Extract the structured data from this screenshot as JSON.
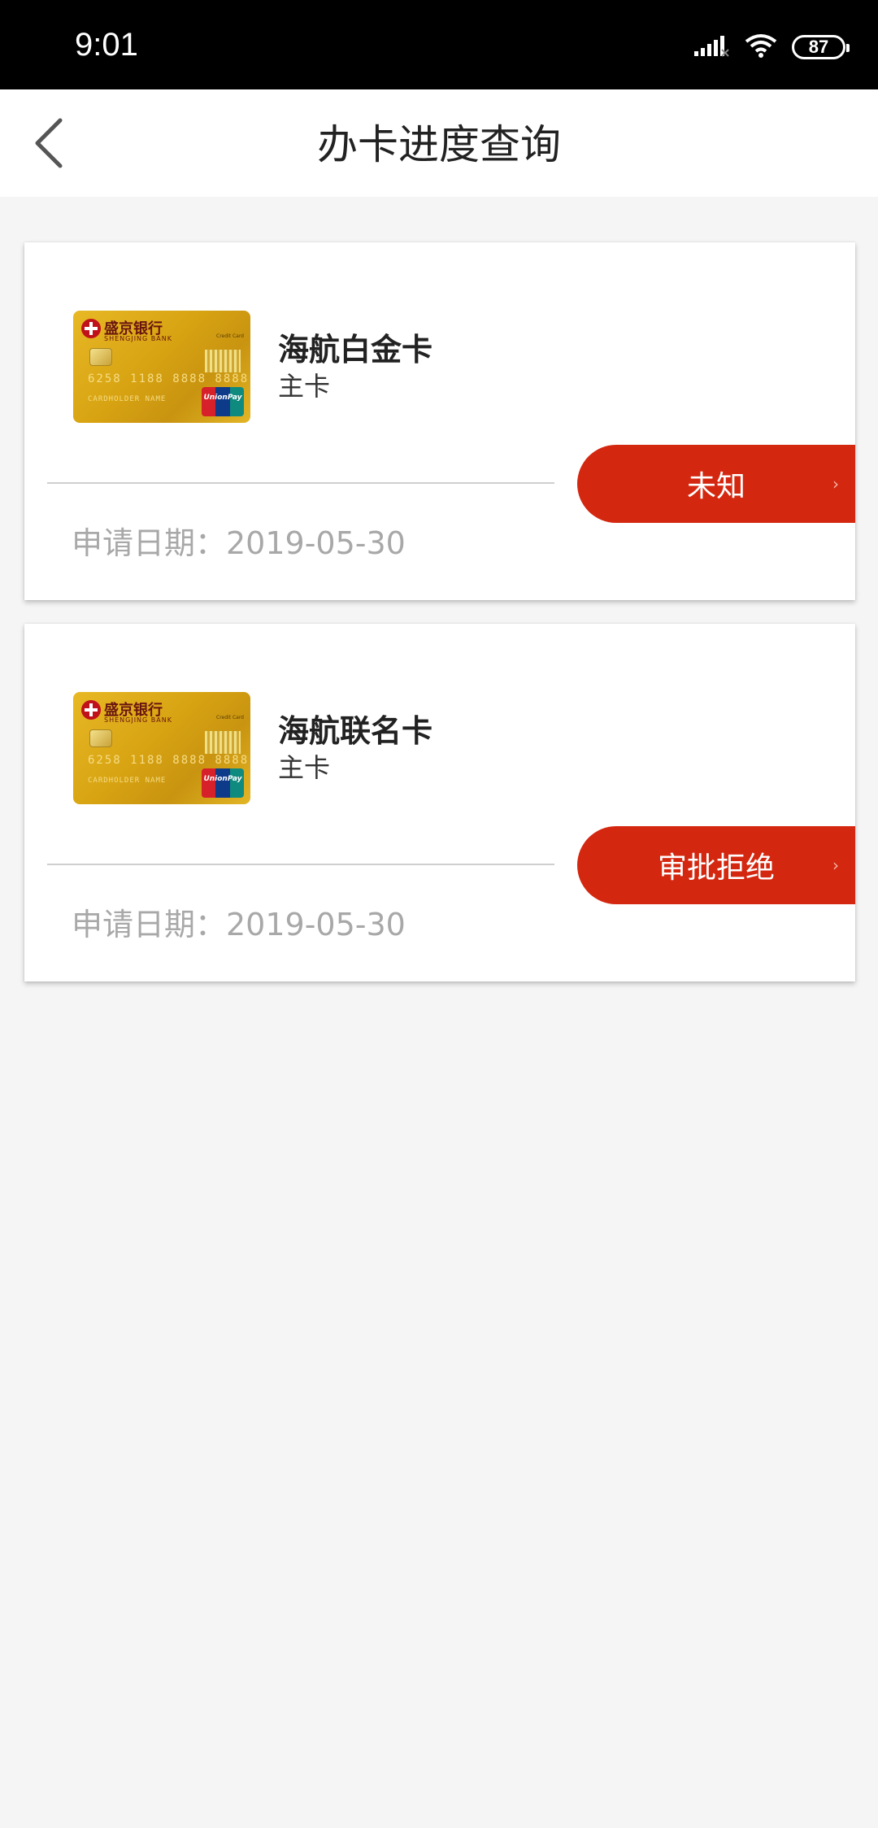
{
  "status_bar": {
    "time": "9:01",
    "battery": "87",
    "icons": [
      "signal-icon",
      "wifi-icon",
      "battery-icon"
    ]
  },
  "navbar": {
    "back_icon": "chevron-left-icon",
    "title": "办卡进度查询"
  },
  "applications": [
    {
      "card_name": "海航白金卡",
      "card_type": "主卡",
      "status": "未知",
      "apply_date": "申请日期：2019-05-30",
      "card_image": {
        "bank_name": "盛京银行",
        "bank_name_en": "SHENGJING BANK",
        "label": "Credit Card",
        "number": "6258 1188 8888 8888",
        "holder": "CARDHOLDER NAME",
        "network": "UnionPay"
      }
    },
    {
      "card_name": "海航联名卡",
      "card_type": "主卡",
      "status": "审批拒绝",
      "apply_date": "申请日期：2019-05-30",
      "card_image": {
        "bank_name": "盛京银行",
        "bank_name_en": "SHENGJING BANK",
        "label": "Credit Card",
        "number": "6258 1188 8888 8888",
        "holder": "CARDHOLDER NAME",
        "network": "UnionPay"
      }
    }
  ],
  "colors": {
    "status_button": "#d4270f",
    "background": "#f5f5f5",
    "date_text": "#a8a8a8"
  }
}
